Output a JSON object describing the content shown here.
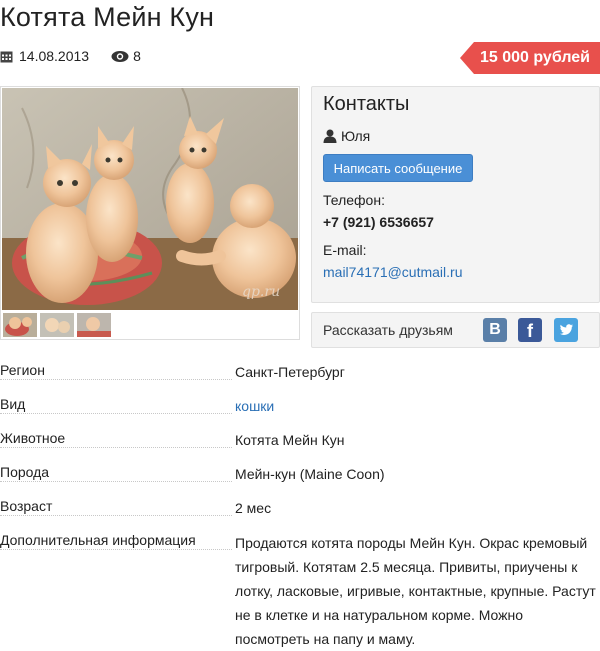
{
  "listing": {
    "title": "Котята Мейн Кун",
    "date": "14.08.2013",
    "views": "8",
    "price": "15 000 рублей"
  },
  "photo": {
    "watermark": "qp.ru",
    "thumbnail_count": 3
  },
  "contacts": {
    "heading": "Контакты",
    "user_name": "Юля",
    "message_button": "Написать сообщение",
    "phone_label": "Телефон:",
    "phone": "+7 (921) 6536657",
    "email_label": "E-mail:",
    "email": "mail74171@cutmail.ru"
  },
  "share": {
    "label": "Рассказать друзьям",
    "vk": "B",
    "facebook": "f"
  },
  "details": [
    {
      "key": "Регион",
      "value": "Санкт-Петербург"
    },
    {
      "key": "Вид",
      "value": "кошки"
    },
    {
      "key": "Животное",
      "value": "Котята Мейн Кун"
    },
    {
      "key": "Порода",
      "value": "Мейн-кун (Maine Coon)"
    },
    {
      "key": "Возраст",
      "value": "2 мес"
    },
    {
      "key": "Дополнительная информация",
      "value": "Продаются котята породы Мейн Кун. Окрас кремовый тигровый. Котятам 2.5 месяца. Привиты, приучены к лотку, ласковые, игривые, контактные, крупные. Растут не в клетке и на натуральном корме. Можно посмотреть на папу и маму."
    }
  ],
  "colors": {
    "price_badge": "#e8504c",
    "button": "#4a8fd6",
    "link": "#2a6fb5",
    "vk": "#5a7fa8",
    "facebook": "#3b5998",
    "twitter": "#4aa3df"
  }
}
